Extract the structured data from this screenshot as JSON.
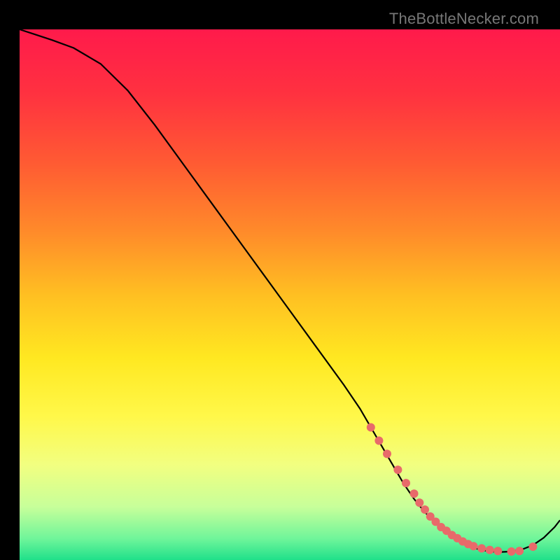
{
  "watermark": "TheBottleNecker.com",
  "chart_data": {
    "type": "line",
    "title": "",
    "xlabel": "",
    "ylabel": "",
    "xlim": [
      0,
      100
    ],
    "ylim": [
      0,
      100
    ],
    "background_gradient": {
      "stops": [
        {
          "offset": 0.0,
          "color": "#ff1a4b"
        },
        {
          "offset": 0.12,
          "color": "#ff3140"
        },
        {
          "offset": 0.25,
          "color": "#ff5a33"
        },
        {
          "offset": 0.38,
          "color": "#ff8a2a"
        },
        {
          "offset": 0.5,
          "color": "#ffbf22"
        },
        {
          "offset": 0.62,
          "color": "#ffe821"
        },
        {
          "offset": 0.73,
          "color": "#fff84a"
        },
        {
          "offset": 0.82,
          "color": "#f2ff80"
        },
        {
          "offset": 0.9,
          "color": "#c7ff9a"
        },
        {
          "offset": 0.96,
          "color": "#6ff59a"
        },
        {
          "offset": 1.0,
          "color": "#1fe08a"
        }
      ]
    },
    "series": [
      {
        "name": "bottleneck-curve",
        "color": "#000000",
        "x": [
          0,
          3,
          6,
          10,
          15,
          20,
          25,
          30,
          35,
          40,
          45,
          50,
          55,
          60,
          63,
          65,
          67,
          69,
          71,
          73,
          75,
          77,
          79,
          81,
          83,
          85,
          87,
          89,
          91,
          93,
          95,
          97,
          99,
          100
        ],
        "y": [
          100,
          99,
          98,
          96.5,
          93.5,
          88.5,
          82,
          75,
          68,
          61,
          54,
          47,
          40,
          33,
          28.5,
          25,
          21.5,
          18,
          14.5,
          11.5,
          9,
          7,
          5.2,
          3.8,
          2.7,
          2,
          1.6,
          1.5,
          1.6,
          2,
          2.8,
          4.2,
          6.2,
          7.5
        ]
      }
    ],
    "markers": {
      "name": "highlight-dots",
      "color": "#e86a6a",
      "radius": 6,
      "x": [
        65,
        66.5,
        68,
        70,
        71.5,
        73,
        74,
        75,
        76,
        77,
        78,
        79,
        80,
        81,
        82,
        83,
        84,
        85.5,
        87,
        88.5,
        91,
        92.5,
        95
      ],
      "y": [
        25,
        22.5,
        20,
        17,
        14.5,
        12.5,
        10.8,
        9.5,
        8.2,
        7.2,
        6.2,
        5.5,
        4.7,
        4.1,
        3.5,
        3.0,
        2.6,
        2.2,
        1.9,
        1.7,
        1.6,
        1.7,
        2.5
      ]
    }
  }
}
